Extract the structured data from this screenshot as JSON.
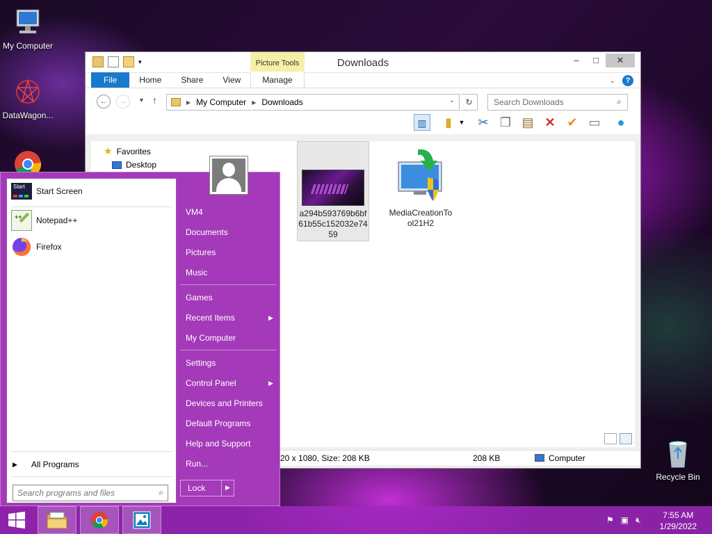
{
  "desktop": {
    "icons": [
      {
        "label": "My Computer"
      },
      {
        "label": "DataWagon..."
      },
      {
        "label": "Recycle Bin"
      }
    ]
  },
  "explorer": {
    "title": "Downloads",
    "contextual_tab_group": "Picture Tools",
    "tabs": [
      "File",
      "Home",
      "Share",
      "View",
      "Manage"
    ],
    "breadcrumb": [
      "My Computer",
      "Downloads"
    ],
    "search_placeholder": "Search Downloads",
    "nav_tree": [
      {
        "label": "Favorites"
      },
      {
        "label": "Desktop"
      }
    ],
    "files": [
      {
        "name": "a294b593769b6bf61b55c152032e7459",
        "name_lines": [
          "a294b593769b6bf",
          "61b55c152032e74",
          "59"
        ],
        "selected": true
      },
      {
        "name": "MediaCreationTool21H2",
        "name_lines": [
          "MediaCreationTo",
          "ol21H2"
        ],
        "selected": false
      }
    ],
    "status": {
      "dimensions": "20 x 1080, Size: 208 KB",
      "size": "208 KB",
      "location": "Computer"
    }
  },
  "start_menu": {
    "pinned": [
      {
        "label": "Start Screen",
        "icon": "start-screen-icon"
      },
      {
        "label": "Notepad++",
        "icon": "notepad-plus-plus-icon"
      },
      {
        "label": "Firefox",
        "icon": "firefox-icon"
      }
    ],
    "all_programs": "All Programs",
    "search_placeholder": "Search programs and files",
    "right_links": [
      {
        "label": "VM4"
      },
      {
        "label": "Documents"
      },
      {
        "label": "Pictures"
      },
      {
        "label": "Music"
      },
      {
        "label": "Games"
      },
      {
        "label": "Recent Items",
        "submenu": true
      },
      {
        "label": "My Computer"
      },
      {
        "label": "Settings"
      },
      {
        "label": "Control Panel",
        "submenu": true
      },
      {
        "label": "Devices and Printers"
      },
      {
        "label": "Default Programs"
      },
      {
        "label": "Help and Support"
      },
      {
        "label": "Run..."
      }
    ],
    "lock_label": "Lock"
  },
  "taskbar": {
    "time": "7:55 AM",
    "date": "1/29/2022",
    "apps": [
      "file-explorer-icon",
      "chrome-icon",
      "photos-icon"
    ]
  },
  "colors": {
    "start_menu_bg": "#a43ab9",
    "file_tab_blue": "#1979ca",
    "picture_tools_yellow": "#f6f0a7"
  }
}
